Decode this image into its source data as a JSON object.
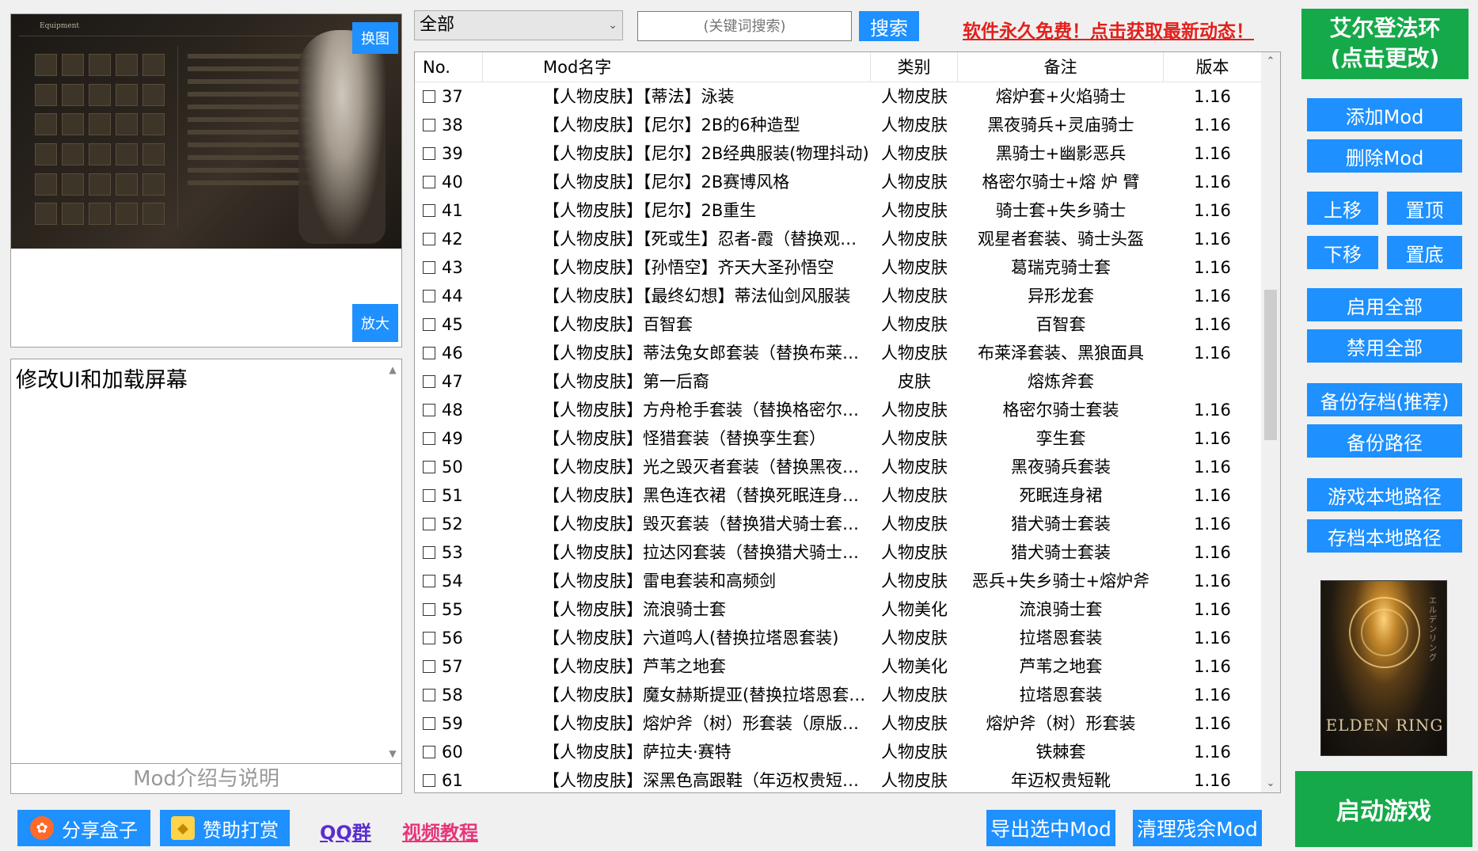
{
  "preview": {
    "swap_label": "换图",
    "zoom_label": "放大"
  },
  "description": {
    "text": "修改UI和加载屏幕",
    "footer": "Mod介绍与说明"
  },
  "toolbar": {
    "category_selected": "全部",
    "search_placeholder": "(关键词搜索)",
    "search_label": "搜索",
    "promo_text": "软件永久免费！点击获取最新动态！"
  },
  "table": {
    "headers": {
      "no": "No.",
      "name": "Mod名字",
      "category": "类别",
      "note": "备注",
      "version": "版本"
    },
    "rows": [
      {
        "no": "37",
        "name": "【人物皮肤】【蒂法】泳装",
        "category": "人物皮肤",
        "note": "熔炉套+火焰骑士",
        "version": "1.16"
      },
      {
        "no": "38",
        "name": "【人物皮肤】【尼尔】2B的6种造型",
        "category": "人物皮肤",
        "note": "黑夜骑兵+灵庙骑士",
        "version": "1.16"
      },
      {
        "no": "39",
        "name": "【人物皮肤】【尼尔】2B经典服装(物理抖动)",
        "category": "人物皮肤",
        "note": "黑骑士+幽影恶兵",
        "version": "1.16"
      },
      {
        "no": "40",
        "name": "【人物皮肤】【尼尔】2B赛博风格",
        "category": "人物皮肤",
        "note": "格密尔骑士+熔 炉 臂",
        "version": "1.16"
      },
      {
        "no": "41",
        "name": "【人物皮肤】【尼尔】2B重生",
        "category": "人物皮肤",
        "note": "骑士套+失乡骑士",
        "version": "1.16"
      },
      {
        "no": "42",
        "name": "【人物皮肤】【死或生】忍者-霞（替换观星者套...",
        "category": "人物皮肤",
        "note": "观星者套装、骑士头盔",
        "version": "1.16"
      },
      {
        "no": "43",
        "name": "【人物皮肤】【孙悟空】齐天大圣孙悟空",
        "category": "人物皮肤",
        "note": "葛瑞克骑士套",
        "version": "1.16"
      },
      {
        "no": "44",
        "name": "【人物皮肤】【最终幻想】蒂法仙剑风服装",
        "category": "人物皮肤",
        "note": "异形龙套",
        "version": "1.16"
      },
      {
        "no": "45",
        "name": "【人物皮肤】百智套",
        "category": "人物皮肤",
        "note": "百智套",
        "version": "1.16"
      },
      {
        "no": "46",
        "name": "【人物皮肤】蒂法兔女郎套装（替换布莱泽套装...",
        "category": "人物皮肤",
        "note": "布莱泽套装、黑狼面具",
        "version": "1.16"
      },
      {
        "no": "47",
        "name": "【人物皮肤】第一后裔",
        "category": "皮肤",
        "note": "熔炼斧套",
        "version": ""
      },
      {
        "no": "48",
        "name": "【人物皮肤】方舟枪手套装（替换格密尔骑士套...",
        "category": "人物皮肤",
        "note": "格密尔骑士套装",
        "version": "1.16"
      },
      {
        "no": "49",
        "name": "【人物皮肤】怪猎套装（替换孪生套）",
        "category": "人物皮肤",
        "note": "孪生套",
        "version": "1.16"
      },
      {
        "no": "50",
        "name": "【人物皮肤】光之毁灭者套装（替换黑夜骑兵套...",
        "category": "人物皮肤",
        "note": "黑夜骑兵套装",
        "version": "1.16"
      },
      {
        "no": "51",
        "name": "【人物皮肤】黑色连衣裙（替换死眠连身裙）",
        "category": "人物皮肤",
        "note": "死眠连身裙",
        "version": "1.16"
      },
      {
        "no": "52",
        "name": "【人物皮肤】毁灭套装（替换猎犬骑士套装）",
        "category": "人物皮肤",
        "note": "猎犬骑士套装",
        "version": "1.16"
      },
      {
        "no": "53",
        "name": "【人物皮肤】拉达冈套装（替换猎犬骑士套装）",
        "category": "人物皮肤",
        "note": "猎犬骑士套装",
        "version": "1.16"
      },
      {
        "no": "54",
        "name": "【人物皮肤】雷电套装和高频剑",
        "category": "人物皮肤",
        "note": "恶兵+失乡骑士+熔炉斧",
        "version": "1.16"
      },
      {
        "no": "55",
        "name": "【人物皮肤】流浪骑士套",
        "category": "人物美化",
        "note": "流浪骑士套",
        "version": "1.16"
      },
      {
        "no": "56",
        "name": "【人物皮肤】六道鸣人(替换拉塔恩套装)",
        "category": "人物皮肤",
        "note": "拉塔恩套装",
        "version": "1.16"
      },
      {
        "no": "57",
        "name": "【人物皮肤】芦苇之地套",
        "category": "人物美化",
        "note": "芦苇之地套",
        "version": "1.16"
      },
      {
        "no": "58",
        "name": "【人物皮肤】魔女赫斯提亚(替换拉塔恩套装)",
        "category": "人物皮肤",
        "note": "拉塔恩套装",
        "version": "1.16"
      },
      {
        "no": "59",
        "name": "【人物皮肤】熔炉斧（树）形套装（原版优化）",
        "category": "人物皮肤",
        "note": "熔炉斧（树）形套装",
        "version": "1.16"
      },
      {
        "no": "60",
        "name": "【人物皮肤】萨拉夫·赛特",
        "category": "人物皮肤",
        "note": "铁棘套",
        "version": "1.16"
      },
      {
        "no": "61",
        "name": "【人物皮肤】深黑色高跟鞋（年迈权贵短靴）",
        "category": "人物皮肤",
        "note": "年迈权贵短靴",
        "version": "1.16"
      }
    ]
  },
  "sidebar": {
    "game_title": "艾尔登法环",
    "game_sub": "(点击更改)",
    "add_mod": "添加Mod",
    "del_mod": "删除Mod",
    "move_up": "上移",
    "to_top": "置顶",
    "move_down": "下移",
    "to_bottom": "置底",
    "enable_all": "启用全部",
    "disable_all": "禁用全部",
    "backup_save": "备份存档(推荐)",
    "backup_path": "备份路径",
    "game_path": "游戏本地路径",
    "save_path": "存档本地路径",
    "cover_logo": "ELDEN RING",
    "start_game": "启动游戏"
  },
  "footer": {
    "share": "分享盒子",
    "donate": "赞助打赏",
    "qq": "QQ群",
    "video": "视频教程",
    "export": "导出选中Mod",
    "clean": "清理残余Mod"
  },
  "colors": {
    "blue_button": "#1e90ff",
    "green_button": "#16a94a",
    "promo_red": "#e2211c",
    "qq_purple": "#5a2dcf",
    "video_pink": "#e7357a"
  }
}
